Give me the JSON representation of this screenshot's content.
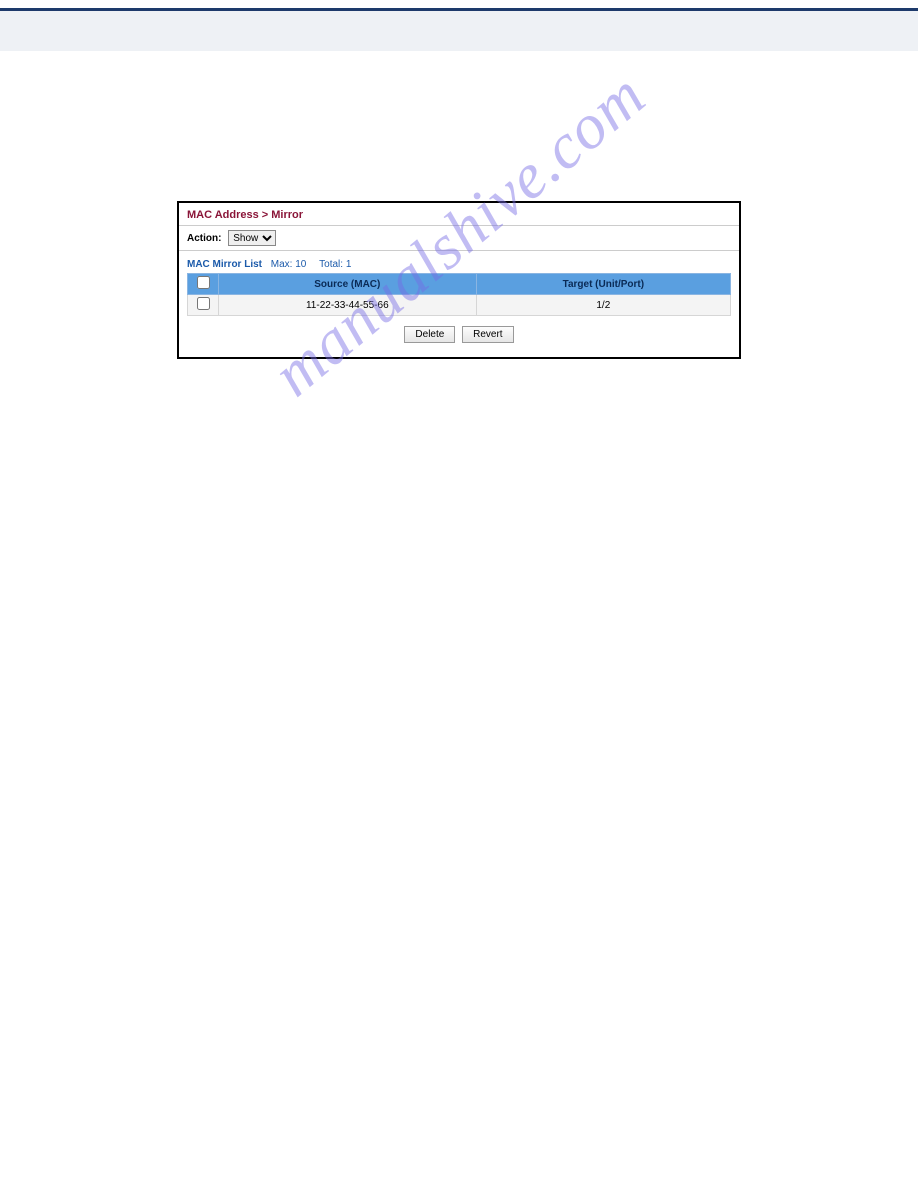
{
  "panel": {
    "title": "MAC Address > Mirror",
    "action_label": "Action:",
    "action_selected": "Show",
    "list_title": "MAC Mirror List",
    "list_max": "Max: 10",
    "list_total": "Total: 1",
    "columns": {
      "source": "Source (MAC)",
      "target": "Target (Unit/Port)"
    },
    "rows": [
      {
        "source": "11-22-33-44-55-66",
        "target": "1/2"
      }
    ],
    "buttons": {
      "delete": "Delete",
      "revert": "Revert"
    }
  },
  "watermark": "manualshive.com"
}
